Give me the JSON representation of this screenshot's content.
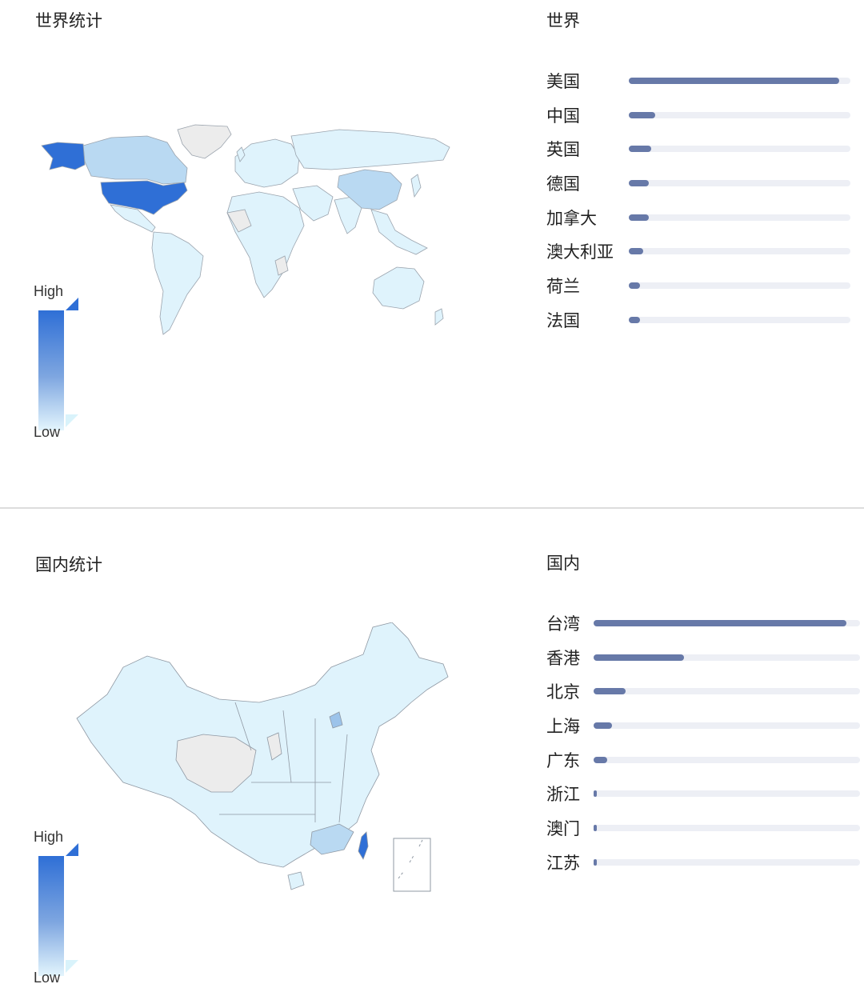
{
  "world": {
    "title": "世界统计",
    "ranking_title": "世界",
    "legend": {
      "high": "High",
      "low": "Low"
    },
    "ranking": [
      {
        "name": "美国",
        "value": 0.95
      },
      {
        "name": "中国",
        "value": 0.12
      },
      {
        "name": "英国",
        "value": 0.1
      },
      {
        "name": "德国",
        "value": 0.09
      },
      {
        "name": "加拿大",
        "value": 0.09
      },
      {
        "name": "澳大利亚",
        "value": 0.065
      },
      {
        "name": "荷兰",
        "value": 0.05
      },
      {
        "name": "法国",
        "value": 0.05
      }
    ]
  },
  "china": {
    "title": "国内统计",
    "ranking_title": "国内",
    "legend": {
      "high": "High",
      "low": "Low"
    },
    "ranking": [
      {
        "name": "台湾",
        "value": 0.95
      },
      {
        "name": "香港",
        "value": 0.34
      },
      {
        "name": "北京",
        "value": 0.12
      },
      {
        "name": "上海",
        "value": 0.07
      },
      {
        "name": "广东",
        "value": 0.05
      },
      {
        "name": "浙江",
        "value": 0.01
      },
      {
        "name": "澳门",
        "value": 0.01
      },
      {
        "name": "江苏",
        "value": 0.01
      }
    ]
  },
  "colors": {
    "high": "#2f6fd6",
    "mid": "#b9d9f2",
    "low": "#dff3fc",
    "no_data": "#ececec",
    "bar_fill": "#6779a8",
    "bar_track": "#edeff5"
  }
}
